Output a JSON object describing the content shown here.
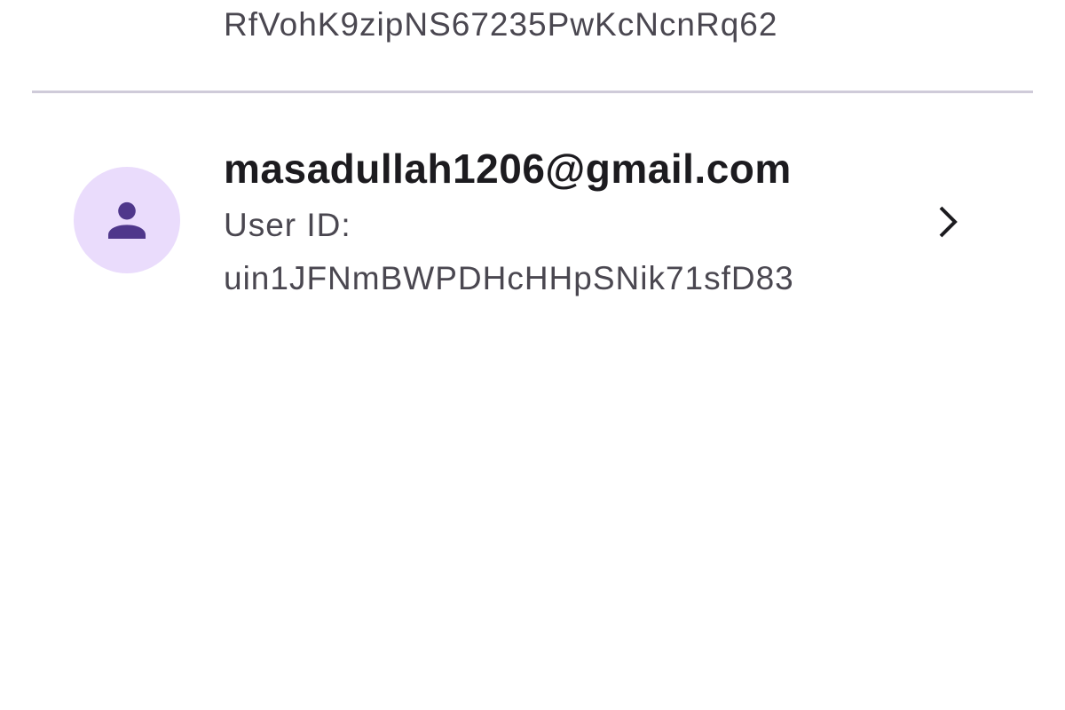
{
  "previous_item": {
    "user_id": "RfVohK9zipNS67235PwKcNcnRq62"
  },
  "user_item": {
    "email": "masadullah1206@gmail.com",
    "user_id_label": "User ID:",
    "user_id": "uin1JFNmBWPDHcHHpSNik71sfD83",
    "avatar_icon": "person-icon",
    "trailing_icon": "chevron-right-icon"
  },
  "colors": {
    "avatar_bg": "#eadcfc",
    "avatar_icon": "#4f378b",
    "divider": "#cfcbd9",
    "primary_text": "#1c1b1f",
    "secondary_text": "#4a4750"
  }
}
